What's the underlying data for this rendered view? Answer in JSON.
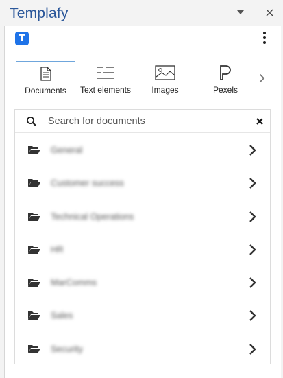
{
  "pane": {
    "title": "Templafy",
    "dropdown_icon": "caret-down-icon",
    "close_icon": "close-icon"
  },
  "addin": {
    "logo_letter": "T",
    "logo_color": "#1e73e8",
    "more_icon": "vertical-ellipsis-icon"
  },
  "tabs": [
    {
      "label": "Documents",
      "icon": "document-icon",
      "active": true
    },
    {
      "label": "Text elements",
      "icon": "text-elements-icon",
      "active": false
    },
    {
      "label": "Images",
      "icon": "image-icon",
      "active": false
    },
    {
      "label": "Pexels",
      "icon": "pexels-icon",
      "active": false
    }
  ],
  "tabs_next_icon": "chevron-right-icon",
  "search": {
    "placeholder": "Search for documents",
    "value": ""
  },
  "folders": [
    {
      "name": "General"
    },
    {
      "name": "Customer success"
    },
    {
      "name": "Technical Operations"
    },
    {
      "name": "HR"
    },
    {
      "name": "MarComms"
    },
    {
      "name": "Sales"
    },
    {
      "name": "Security"
    }
  ],
  "colors": {
    "accent": "#2b579a",
    "active_tab_border": "#6fa6dc"
  }
}
